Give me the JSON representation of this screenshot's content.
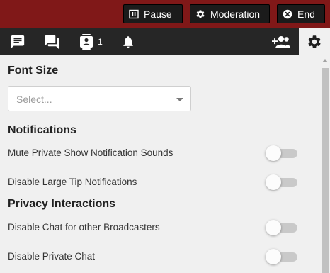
{
  "topbar": {
    "pause_label": "Pause",
    "moderation_label": "Moderation",
    "end_label": "End"
  },
  "tabs": {
    "users_count": "1"
  },
  "settings": {
    "font_size_heading": "Font Size",
    "font_size_select": {
      "placeholder": "Select..."
    },
    "notifications_heading": "Notifications",
    "notifications": [
      {
        "label": "Mute Private Show Notification Sounds",
        "enabled": false
      },
      {
        "label": "Disable Large Tip Notifications",
        "enabled": false
      }
    ],
    "privacy_heading": "Privacy Interactions",
    "privacy": [
      {
        "label": "Disable Chat for other Broadcasters",
        "enabled": false
      },
      {
        "label": "Disable Private Chat",
        "enabled": false
      }
    ]
  },
  "colors": {
    "topbar_bg": "#801818",
    "tabbar_bg": "#262626",
    "panel_bg": "#f0f0f0",
    "button_bg": "#1b1b1b"
  },
  "icons": {
    "pause": "pause-icon",
    "moderation": "gear-icon",
    "end": "close-circle-icon",
    "chat": "chat-bubble-icon",
    "private_messages": "forum-icon",
    "users": "user-list-icon",
    "notifications": "bell-icon",
    "add_user": "add-user-icon",
    "settings": "gear-icon"
  }
}
